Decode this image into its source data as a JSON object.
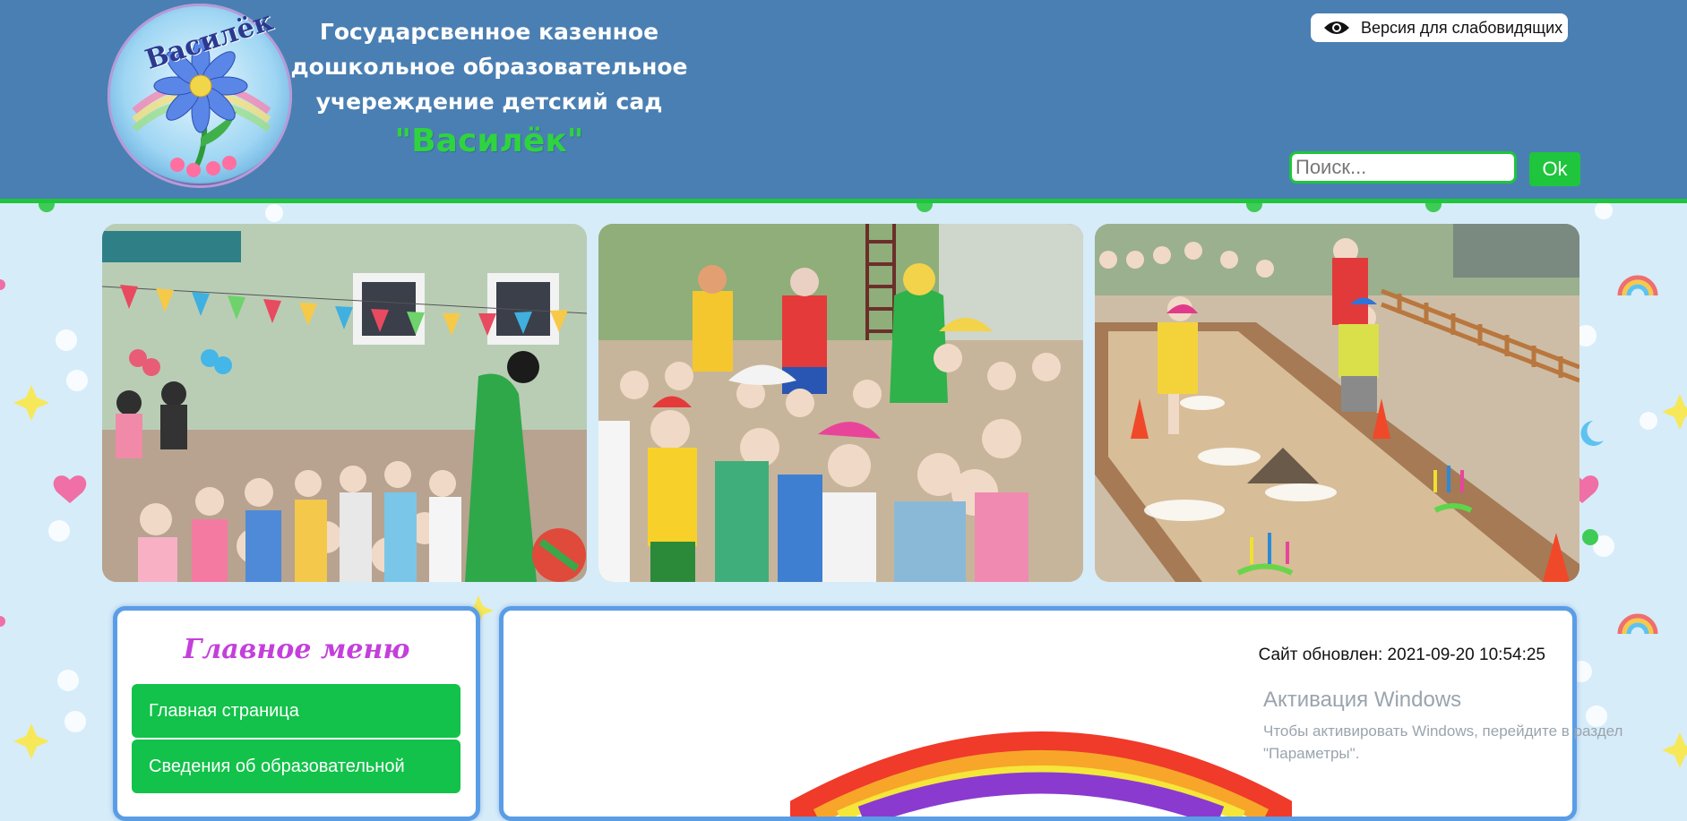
{
  "header": {
    "logo_text": "Василёк",
    "org_title_line1": "Государсвенное казенное",
    "org_title_line2": "дошкольное образовательное",
    "org_title_line3": "учереждение детский сад",
    "org_name": "\"Василёк\"",
    "vision_label": "Версия для слабовидящих",
    "search": {
      "placeholder": "Поиск...",
      "button_label": "Ok"
    }
  },
  "colors": {
    "header_bg": "#4a7fb3",
    "accent_green": "#1fc53c",
    "menu_title": "#c43fdb",
    "panel_border": "#5a9de6",
    "page_bg": "#d6ecf9"
  },
  "photos": [
    {
      "name": "children-outdoor-festival-photo"
    },
    {
      "name": "children-with-clowns-photo"
    },
    {
      "name": "children-playing-games-photo"
    }
  ],
  "menu": {
    "title": "Главное меню",
    "items": [
      {
        "label": "Главная страница"
      },
      {
        "label": "Сведения об образовательной"
      }
    ]
  },
  "content": {
    "updated": "Сайт обновлен: 2021-09-20 10:54:25"
  },
  "overlay": {
    "activation_title": "Активация Windows",
    "activation_line1": "Чтобы активировать Windows, перейдите в раздел",
    "activation_line2": "\"Параметры\"."
  }
}
